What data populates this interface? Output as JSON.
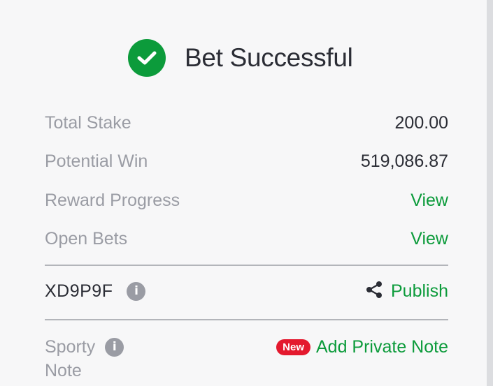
{
  "header": {
    "title": "Bet Successful",
    "status_icon": "check-circle-icon",
    "status_color": "#0c9b3b"
  },
  "summary": {
    "total_stake_label": "Total Stake",
    "total_stake_value": "200.00",
    "potential_win_label": "Potential Win",
    "potential_win_value": "519,086.87",
    "reward_progress_label": "Reward Progress",
    "reward_progress_link": "View",
    "open_bets_label": "Open Bets",
    "open_bets_link": "View"
  },
  "booking": {
    "code": "XD9P9F",
    "info_icon": "info-icon",
    "share_icon": "share-icon",
    "publish_label": "Publish"
  },
  "note": {
    "label_line1": "Sporty",
    "label_line2": "Note",
    "new_badge": "New",
    "add_label": "Add Private Note"
  },
  "colors": {
    "accent": "#0c9b3b",
    "badge": "#e4192e",
    "muted_text": "#9a9ca4",
    "primary_text": "#2b2d35"
  }
}
